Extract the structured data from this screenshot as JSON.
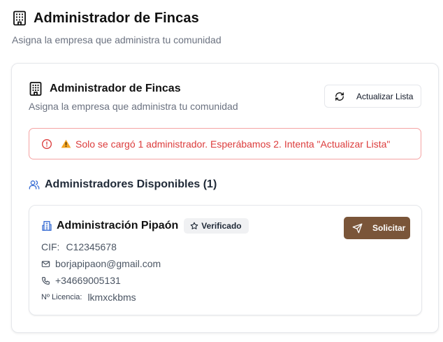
{
  "header": {
    "title": "Administrador de Fincas",
    "subtitle": "Asigna la empresa que administra tu comunidad",
    "icon": "building-icon"
  },
  "card": {
    "title": "Administrador de Fincas",
    "subtitle": "Asigna la empresa que administra tu comunidad",
    "refresh_label": "Actualizar Lista",
    "alert": {
      "text": "Solo se cargó 1 administrador. Esperábamos 2. Intenta \"Actualizar Lista\"",
      "color": "#dc3c3c"
    },
    "section_title": "Administradores Disponibles (1)",
    "admins": [
      {
        "name": "Administración Pipaón",
        "badge": "Verificado",
        "request_label": "Solicitar",
        "cif_label": "CIF:",
        "cif": "C12345678",
        "email": "borjapipaon@gmail.com",
        "phone": "+34669005131",
        "license_label": "Nº Licencia:",
        "license": "lkmxckbms"
      }
    ]
  },
  "colors": {
    "accent_brown": "#7a5539",
    "alert_red": "#dc3c3c",
    "icon_blue": "#3b6fd4"
  }
}
